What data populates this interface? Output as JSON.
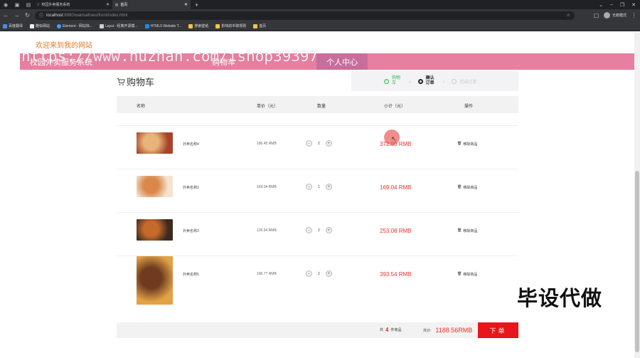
{
  "browser": {
    "tabs": [
      {
        "title": "校园外卖服务系统",
        "active": false
      },
      {
        "title": "首页",
        "active": true
      }
    ],
    "url_host": "localhost",
    "url_rest": ":8080/waimaifuwu/front/index.html",
    "profile": "无痕模式",
    "bookmarks": [
      "百度翻译",
      "酷标网站",
      "Element - 网站快...",
      "Layui - 经典开源模...",
      "HTML5 Website T...",
      "搜索壁纸",
      "影响的中职规则",
      "首页"
    ]
  },
  "page": {
    "welcome": "欢迎来到我的网站",
    "nav": [
      "校园外卖服务系统",
      "购物车",
      "个人中心"
    ],
    "watermark": "https://www.huzhan.com/ishop39397",
    "cart_title": "购物车",
    "steps": [
      {
        "label": "购物车",
        "state": "done"
      },
      {
        "label": "确认订单",
        "state": "current"
      },
      {
        "label": "完成订单",
        "state": "next"
      }
    ],
    "headers": {
      "name": "名称",
      "price": "单价（元）",
      "qty": "数量",
      "subtotal": "小计（元）",
      "action": "操作"
    },
    "items": [
      {
        "name": "外卖名称4",
        "price": "186.45 RMB",
        "qty": "2",
        "subtotal": "372.90 RMB",
        "delete": "移除商品",
        "colors": [
          "#a6432a",
          "#e9b47a"
        ]
      },
      {
        "name": "外卖名称2",
        "price": "169.04 RMB",
        "qty": "1",
        "subtotal": "169.04 RMB",
        "delete": "移除商品",
        "colors": [
          "#f4e4cf",
          "#d9874a"
        ]
      },
      {
        "name": "外卖名称3",
        "price": "126.54 RMB",
        "qty": "2",
        "subtotal": "253.08 RMB",
        "delete": "移除商品",
        "colors": [
          "#3d2a1f",
          "#c46a2b"
        ]
      },
      {
        "name": "外卖名称5",
        "price": "196.77 RMB",
        "qty": "2",
        "subtotal": "393.54 RMB",
        "delete": "移除商品",
        "colors": [
          "#e2a246",
          "#6e3b1f"
        ]
      }
    ],
    "footer": {
      "count_prefix": "共",
      "count": "4",
      "count_suffix": "件商品",
      "total_label": "共计:",
      "total": "1188.56RMB",
      "order": "下单"
    },
    "promo": "毕设代做"
  }
}
